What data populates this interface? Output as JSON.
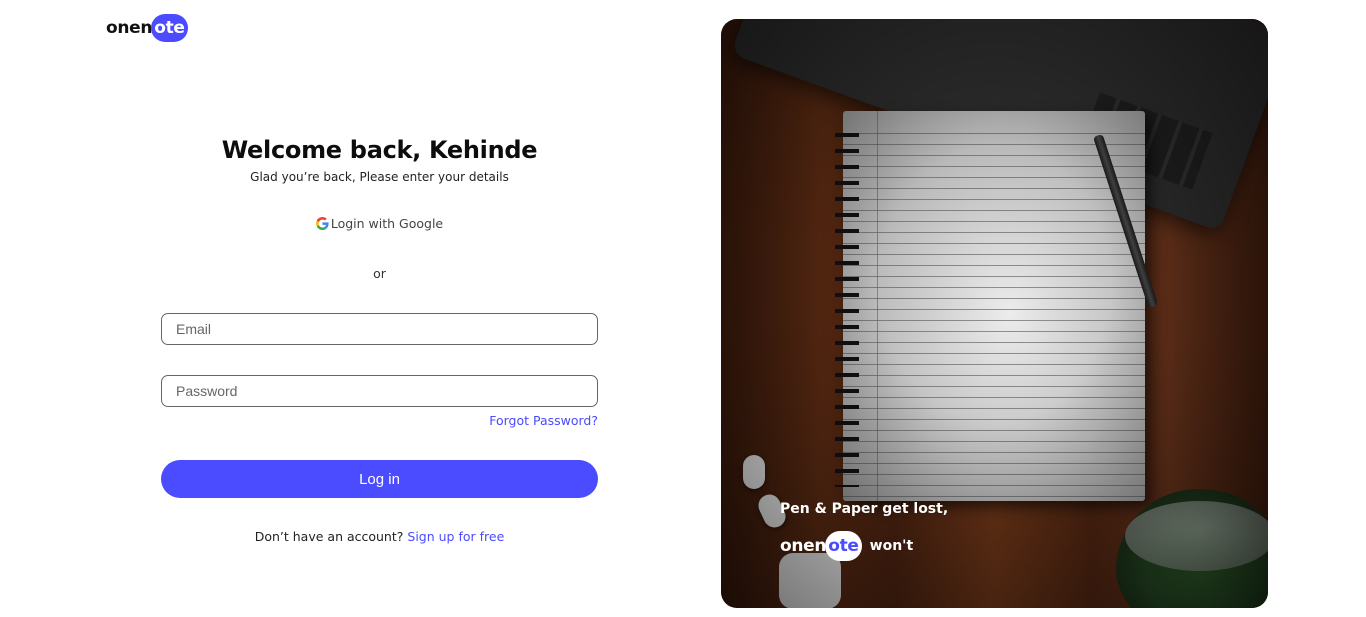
{
  "brand": {
    "prefix": "onen",
    "highlight": "ote",
    "accent_color": "#4b4bff"
  },
  "login": {
    "title": "Welcome back, Kehinde",
    "subtitle": "Glad you’re back, Please enter your details",
    "google_label": "Login with Google",
    "separator": "or",
    "email": {
      "placeholder": "Email",
      "value": ""
    },
    "password": {
      "placeholder": "Password",
      "value": ""
    },
    "forgot_label": "Forgot Password?",
    "submit_label": "Log in",
    "signup_prompt": "Don’t have an account?",
    "signup_link": "Sign up for free"
  },
  "hero": {
    "caption": "Pen & Paper get lost,",
    "brand_prefix": "onen",
    "brand_highlight": "ote",
    "tagline": "won't"
  }
}
